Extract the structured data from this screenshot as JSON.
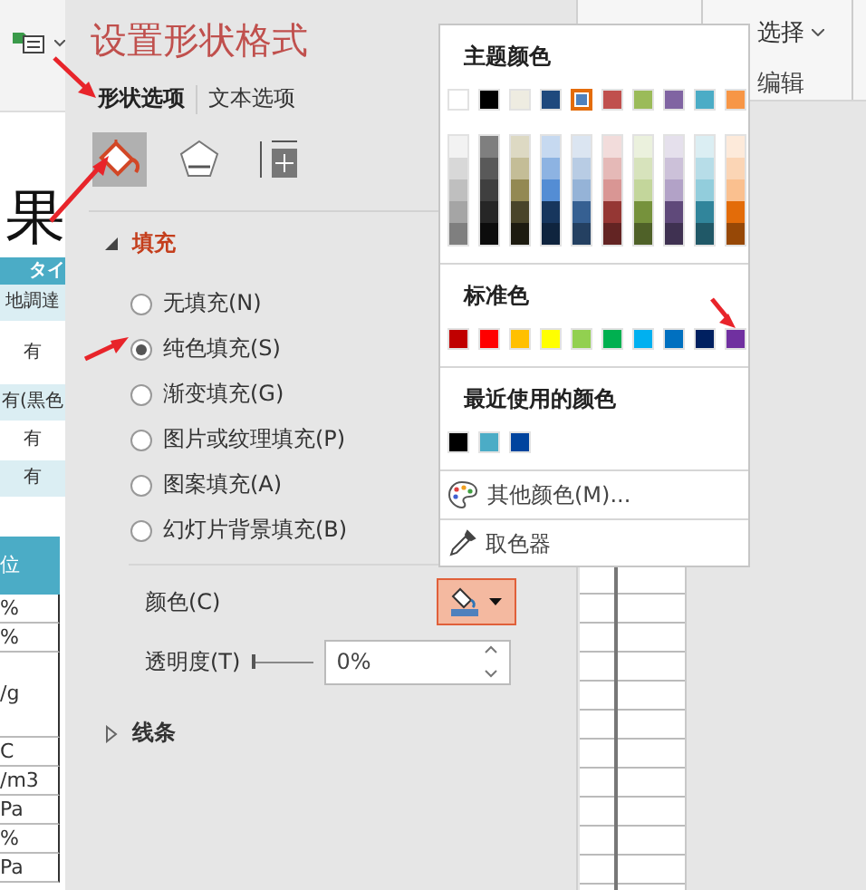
{
  "ribbon": {
    "select_button": "选择",
    "group_label": "编辑"
  },
  "sheet": {
    "heading": "果",
    "header_1": "タイ",
    "rows_1": [
      {
        "text": "地調達",
        "shaded": true
      },
      {
        "text": "有",
        "shaded": false
      },
      {
        "text": "有(黒色",
        "shaded": true
      },
      {
        "text": "有",
        "shaded": false
      },
      {
        "text": "有",
        "shaded": true
      }
    ],
    "header_2": "位",
    "rows_2": [
      "%",
      "%",
      "/g",
      "C",
      "/m3",
      "Pa",
      "%",
      "Pa"
    ]
  },
  "panel": {
    "title": "设置形状格式",
    "tabs": [
      {
        "label": "形状选项",
        "selected": true
      },
      {
        "label": "文本选项",
        "selected": false
      }
    ],
    "icon_tabs": [
      {
        "kind": "fill",
        "selected": true
      },
      {
        "kind": "effects",
        "selected": false
      },
      {
        "kind": "size",
        "selected": false
      }
    ],
    "fill": {
      "label": "填充",
      "expanded": true,
      "options": [
        {
          "label": "无填充(N)",
          "selected": false
        },
        {
          "label": "纯色填充(S)",
          "selected": true
        },
        {
          "label": "渐变填充(G)",
          "selected": false
        },
        {
          "label": "图片或纹理填充(P)",
          "selected": false
        },
        {
          "label": "图案填充(A)",
          "selected": false
        },
        {
          "label": "幻灯片背景填充(B)",
          "selected": false
        }
      ],
      "color_label": "颜色(C)",
      "color_button_open": true,
      "transparency": {
        "label": "透明度(T)",
        "level": 0,
        "value": "0%"
      }
    },
    "line": {
      "label": "线条",
      "expanded": false
    }
  },
  "color_menu": {
    "theme_title": "主题颜色",
    "theme_colors": [
      {
        "color": "#ffffff",
        "selected": false
      },
      {
        "color": "#000000",
        "selected": false
      },
      {
        "color": "#eeece1",
        "selected": false
      },
      {
        "color": "#1f497d",
        "selected": false
      },
      {
        "color": "#4f81bd",
        "selected": true
      },
      {
        "color": "#c0504d",
        "selected": false
      },
      {
        "color": "#9bbb59",
        "selected": false
      },
      {
        "color": "#8064a2",
        "selected": false
      },
      {
        "color": "#4bacc6",
        "selected": false
      },
      {
        "color": "#f79646",
        "selected": false
      }
    ],
    "shades": [
      {
        "colors": [
          {
            "color": "#f2f2f2"
          },
          {
            "color": "#d8d8d8"
          },
          {
            "color": "#bfbfbf"
          },
          {
            "color": "#a5a5a5"
          },
          {
            "color": "#7f7f7f"
          }
        ]
      },
      {
        "colors": [
          {
            "color": "#7f7f7f"
          },
          {
            "color": "#595959"
          },
          {
            "color": "#3f3f3f"
          },
          {
            "color": "#262626"
          },
          {
            "color": "#0c0c0c"
          }
        ]
      },
      {
        "colors": [
          {
            "color": "#ddd9c3"
          },
          {
            "color": "#c4bd97"
          },
          {
            "color": "#938953"
          },
          {
            "color": "#494429"
          },
          {
            "color": "#1d1b10"
          }
        ]
      },
      {
        "colors": [
          {
            "color": "#c6d9f0"
          },
          {
            "color": "#8db3e2"
          },
          {
            "color": "#548dd4"
          },
          {
            "color": "#17365d"
          },
          {
            "color": "#0f243e"
          }
        ]
      },
      {
        "colors": [
          {
            "color": "#dbe5f1"
          },
          {
            "color": "#b8cce4"
          },
          {
            "color": "#95b3d7"
          },
          {
            "color": "#366092"
          },
          {
            "color": "#244061"
          }
        ]
      },
      {
        "colors": [
          {
            "color": "#f2dcdb"
          },
          {
            "color": "#e5b9b7"
          },
          {
            "color": "#d99694"
          },
          {
            "color": "#953734"
          },
          {
            "color": "#632423"
          }
        ]
      },
      {
        "colors": [
          {
            "color": "#ebf1dd"
          },
          {
            "color": "#d7e3bc"
          },
          {
            "color": "#c3d69b"
          },
          {
            "color": "#76923c"
          },
          {
            "color": "#4f6128"
          }
        ]
      },
      {
        "colors": [
          {
            "color": "#e5e0ec"
          },
          {
            "color": "#ccc1d9"
          },
          {
            "color": "#b2a2c7"
          },
          {
            "color": "#5f497a"
          },
          {
            "color": "#3f3151"
          }
        ]
      },
      {
        "colors": [
          {
            "color": "#dbeef3"
          },
          {
            "color": "#b7dde8"
          },
          {
            "color": "#92cddc"
          },
          {
            "color": "#31859b"
          },
          {
            "color": "#205867"
          }
        ]
      },
      {
        "colors": [
          {
            "color": "#fdeada"
          },
          {
            "color": "#fbd5b5"
          },
          {
            "color": "#fac08f"
          },
          {
            "color": "#e36c09"
          },
          {
            "color": "#974806"
          }
        ]
      }
    ],
    "standard_title": "标准色",
    "standard_colors": [
      {
        "color": "#c00000"
      },
      {
        "color": "#ff0000"
      },
      {
        "color": "#ffc000"
      },
      {
        "color": "#ffff00"
      },
      {
        "color": "#92d050"
      },
      {
        "color": "#00b050"
      },
      {
        "color": "#00b0f0"
      },
      {
        "color": "#0070c0"
      },
      {
        "color": "#002060"
      },
      {
        "color": "#7030a0"
      }
    ],
    "recent_title": "最近使用的颜色",
    "recent_colors": [
      {
        "color": "#000000"
      },
      {
        "color": "#4bacc6"
      },
      {
        "color": "#00449e"
      }
    ],
    "more_colors": "其他颜色(M)...",
    "eyedropper": "取色器"
  }
}
